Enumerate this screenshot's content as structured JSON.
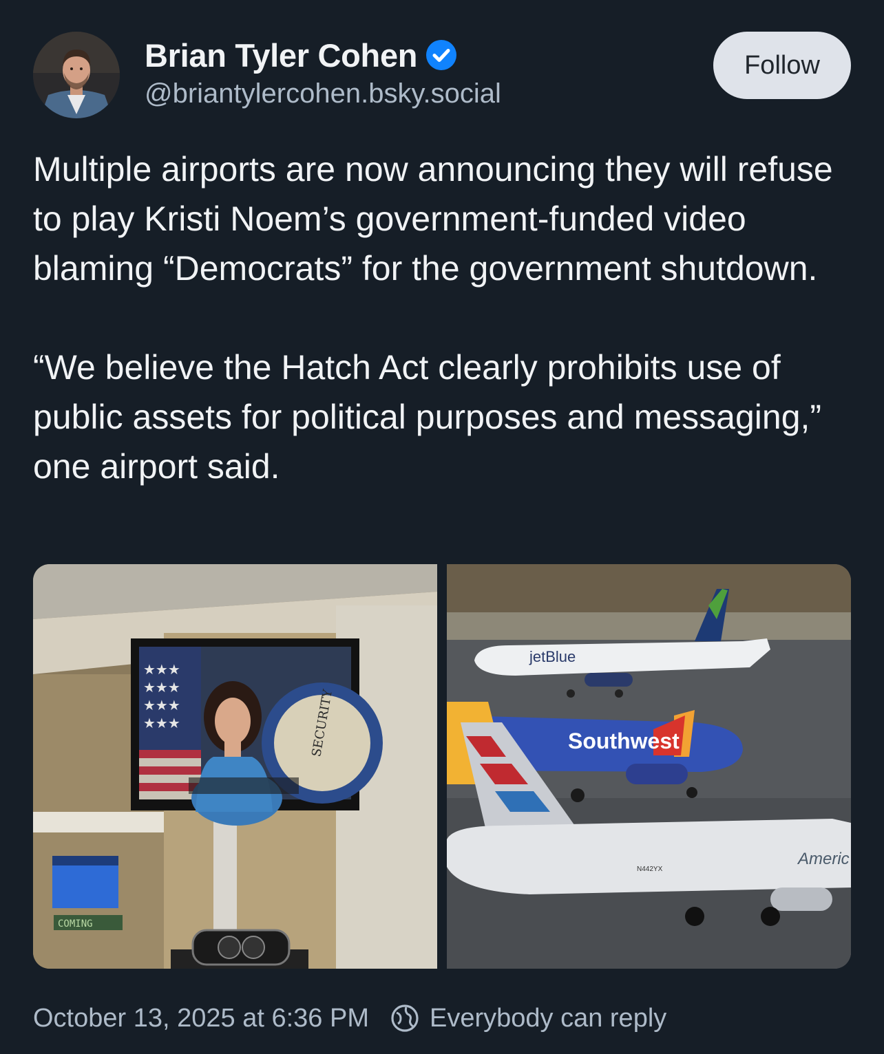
{
  "author": {
    "display_name": "Brian Tyler Cohen",
    "handle": "@briantylercohen.bsky.social",
    "verified": true,
    "verified_color": "#1083fe"
  },
  "follow_button": {
    "label": "Follow"
  },
  "post": {
    "paragraphs": [
      "Multiple airports are now announcing they will refuse to play Kristi Noem’s government-funded video blaming “Democrats” for the government shutdown.",
      "“We believe the Hatch Act clearly prohibits use of public assets for political purposes and messaging,” one airport said."
    ]
  },
  "media": {
    "left_image": {
      "icon": "airport-tv-photo",
      "seal_text": "SECURITY",
      "sign_text": "COMING"
    },
    "right_image": {
      "icon": "airport-planes-photo",
      "plane_labels": [
        "jetBlue",
        "Southwest",
        "Americ",
        "N442YX"
      ]
    }
  },
  "footer": {
    "timestamp": "October 13, 2025 at 6:36 PM",
    "reply_setting": "Everybody can reply",
    "reply_icon": "globe-icon"
  },
  "colors": {
    "background": "#161e27",
    "text": "#f1f3f5",
    "muted": "#aebbc9",
    "follow_bg": "#dfe3ea"
  }
}
